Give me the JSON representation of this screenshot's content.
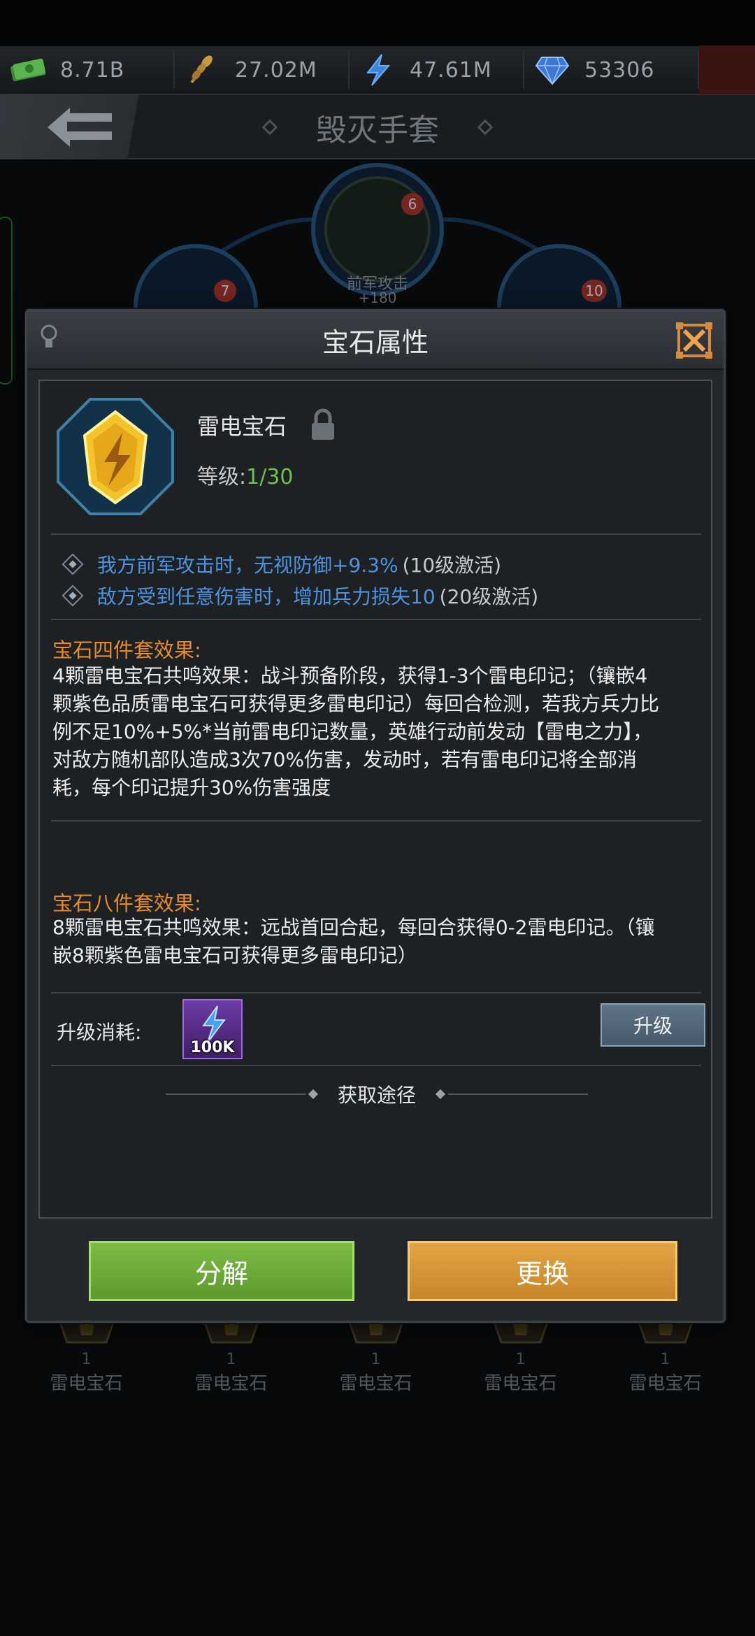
{
  "resources": [
    {
      "icon": "cash-icon",
      "value": "8.71B"
    },
    {
      "icon": "wheat-icon",
      "value": "27.02M"
    },
    {
      "icon": "lightning-icon",
      "value": "47.61M"
    },
    {
      "icon": "diamond-icon",
      "value": "53306"
    }
  ],
  "header": {
    "title": "毁灭手套"
  },
  "tree": {
    "top_badge": "6",
    "top_label": "前军攻击",
    "top_sub": "+180",
    "left_badge": "7",
    "right_badge": "10"
  },
  "modal": {
    "title": "宝石属性",
    "gem": {
      "name": "雷电宝石",
      "level_label": "等级:",
      "level_value": "1/30"
    },
    "attributes": [
      {
        "text": "我方前军攻击时，无视防御+9.3%",
        "note": "(10级激活)"
      },
      {
        "text": "敌方受到任意伤害时，增加兵力损失10",
        "note": "(20级激活)"
      }
    ],
    "set4": {
      "title": "宝石四件套效果:",
      "lines": [
        "4颗雷电宝石共鸣效果：战斗预备阶段，获得1-3个雷电印记；（镶嵌4",
        "颗紫色品质雷电宝石可获得更多雷电印记）每回合检测，若我方兵力比",
        "例不足10%+5%*当前雷电印记数量，英雄行动前发动【雷电之力】，",
        "对敌方随机部队造成3次70%伤害，发动时，若有雷电印记将全部消",
        "耗，每个印记提升30%伤害强度"
      ]
    },
    "set8": {
      "title": "宝石八件套效果:",
      "lines": [
        "8颗雷电宝石共鸣效果：远战首回合起，每回合获得0-2雷电印记。（镶",
        "嵌8颗紫色雷电宝石可获得更多雷电印记）"
      ]
    },
    "cost": {
      "label": "升级消耗:",
      "item_qty": "100K"
    },
    "upgrade_label": "升级",
    "source_label": "获取途径",
    "decompose_label": "分解",
    "replace_label": "更换"
  },
  "bottom_gems": [
    {
      "count": "1",
      "name": "雷电宝石"
    },
    {
      "count": "1",
      "name": "雷电宝石"
    },
    {
      "count": "1",
      "name": "雷电宝石"
    },
    {
      "count": "1",
      "name": "雷电宝石"
    },
    {
      "count": "1",
      "name": "雷电宝石"
    }
  ],
  "colors": {
    "accent_orange": "#e88b2e",
    "attr_blue": "#4f93e0",
    "level_green": "#6cc24a",
    "button_green": "#6aa83a",
    "button_orange": "#d6952f"
  }
}
